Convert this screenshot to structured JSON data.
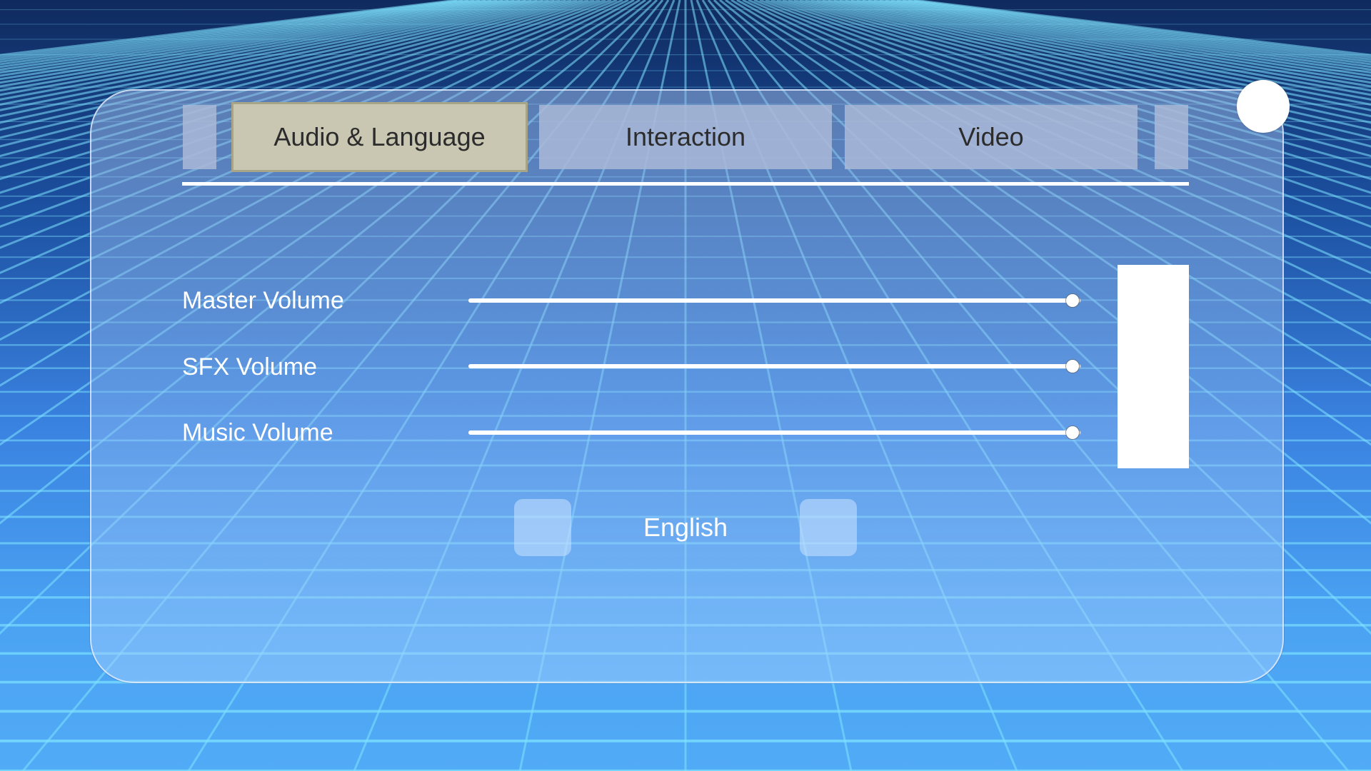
{
  "tabs": [
    {
      "label": "Audio & Language",
      "active": true
    },
    {
      "label": "Interaction",
      "active": false
    },
    {
      "label": "Video",
      "active": false
    }
  ],
  "settings": {
    "master_volume": {
      "label": "Master Volume",
      "value": 1.0
    },
    "sfx_volume": {
      "label": "SFX Volume",
      "value": 1.0
    },
    "music_volume": {
      "label": "Music Volume",
      "value": 1.0
    }
  },
  "language": {
    "selected": "English"
  },
  "icons": {
    "close": "close-button-circle",
    "prev": "previous-language-button",
    "next": "next-language-button"
  },
  "colors": {
    "active_tab": "#c9c7b1",
    "inactive_tab": "#aab9d7",
    "accent": "#ffffff",
    "grid_line": "#7fe3ff"
  }
}
